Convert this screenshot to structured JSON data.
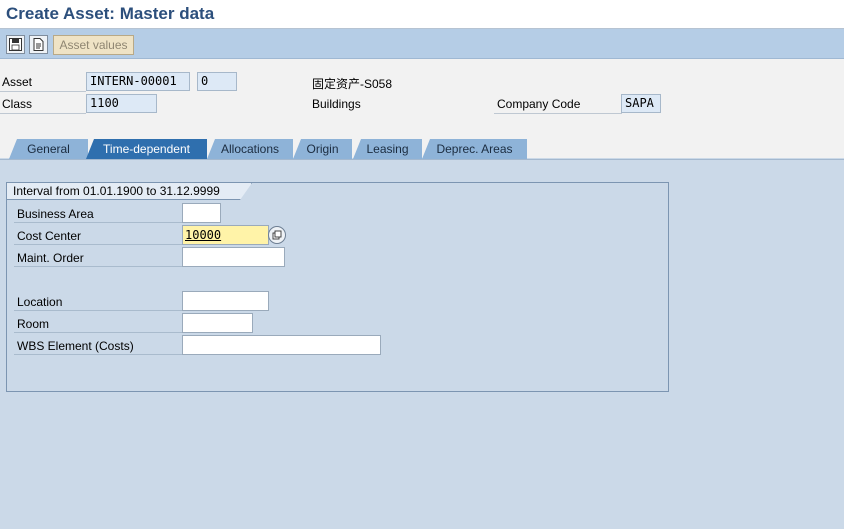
{
  "window": {
    "title": "Create Asset:  Master data"
  },
  "toolbar": {
    "buttons": [
      {
        "icon": "save-icon"
      },
      {
        "icon": "document-icon"
      }
    ],
    "asset_values_label": "Asset values"
  },
  "header": {
    "asset_label": "Asset",
    "asset_number": "INTERN-00001",
    "asset_subnumber": "0",
    "asset_description": "固定资产-S058",
    "class_label": "Class",
    "class_value": "1100",
    "class_description": "Buildings",
    "company_code_label": "Company Code",
    "company_code_value": "SAPA"
  },
  "tabs": [
    {
      "label": "General",
      "active": false
    },
    {
      "label": "Time-dependent",
      "active": true
    },
    {
      "label": "Allocations",
      "active": false
    },
    {
      "label": "Origin",
      "active": false
    },
    {
      "label": "Leasing",
      "active": false
    },
    {
      "label": "Deprec. Areas",
      "active": false
    }
  ],
  "interval": {
    "title": "Interval from 01.01.1900 to 31.12.9999",
    "fields": {
      "business_area": {
        "label": "Business Area",
        "value": ""
      },
      "cost_center": {
        "label": "Cost Center",
        "value": "10000"
      },
      "maint_order": {
        "label": "Maint. Order",
        "value": ""
      },
      "location": {
        "label": "Location",
        "value": ""
      },
      "room": {
        "label": "Room",
        "value": ""
      },
      "wbs_element": {
        "label": "WBS Element (Costs)",
        "value": ""
      }
    }
  },
  "colors": {
    "title": "#2c4f7c",
    "toolbar": "#b5cde6",
    "tab_active": "#2f6fae",
    "tab_inactive": "#8eb3d8",
    "body": "#cbd9e8",
    "focus_field": "#fff3a8"
  }
}
